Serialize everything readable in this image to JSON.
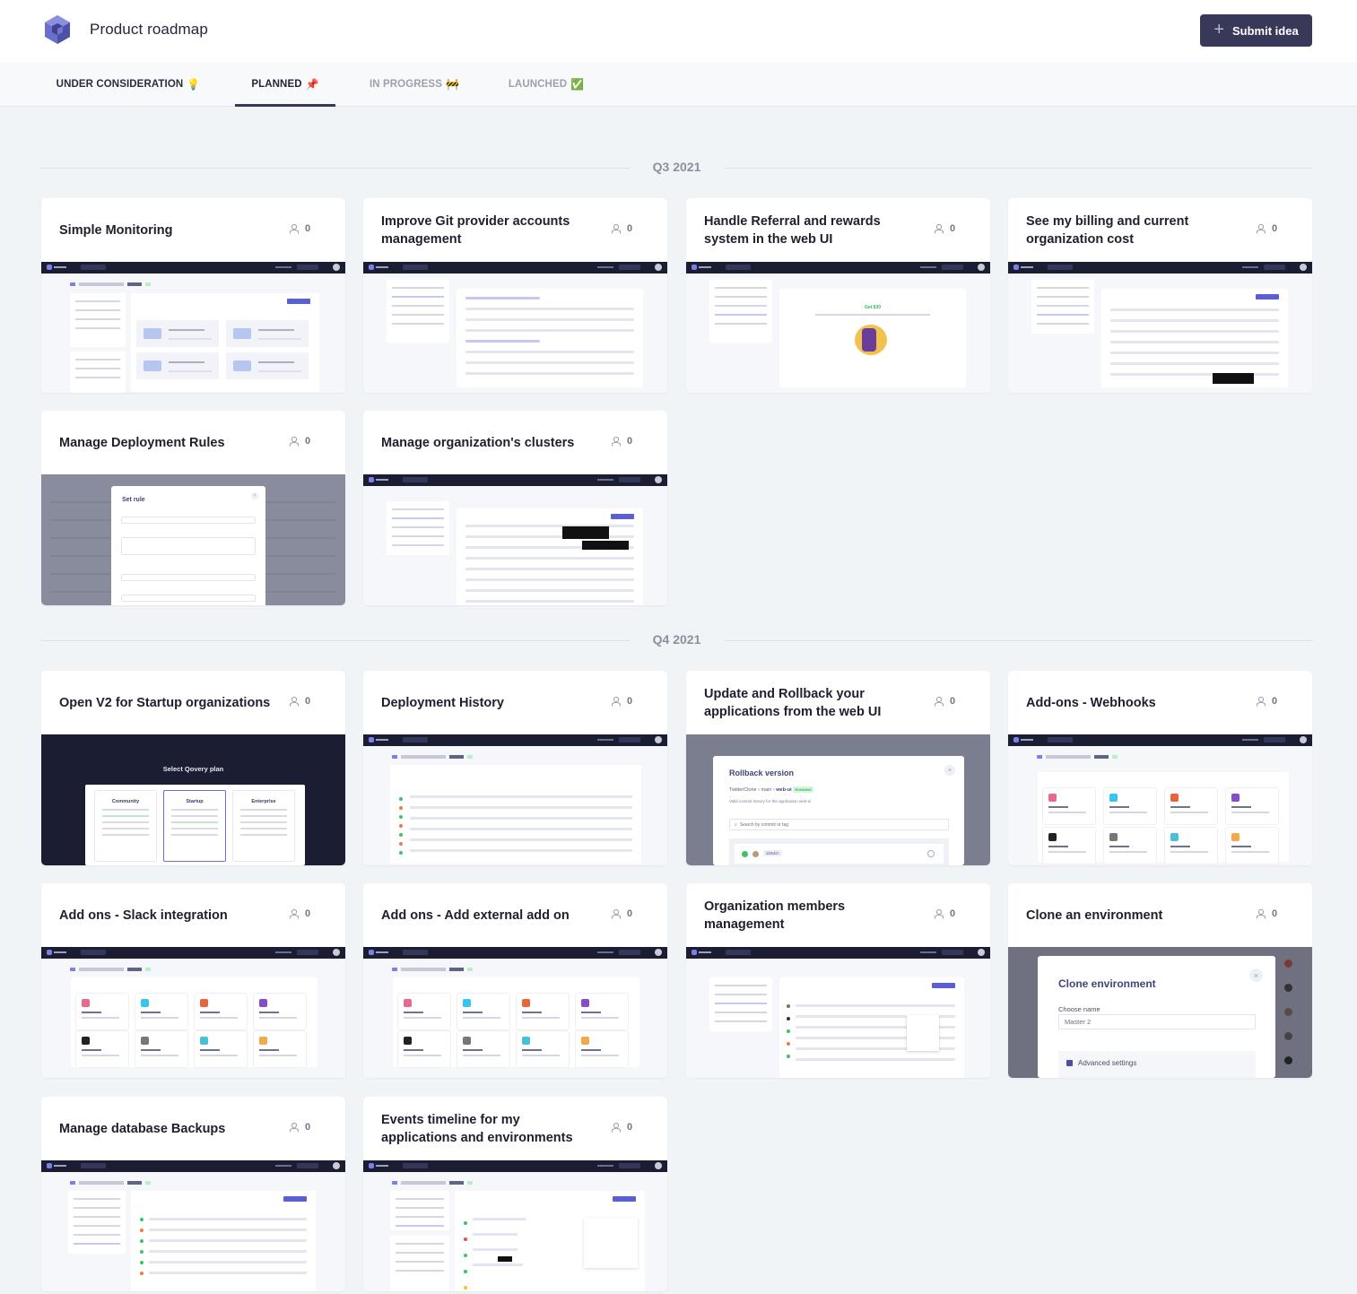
{
  "header": {
    "title": "Product roadmap",
    "submit_button": "Submit idea",
    "submit_icon": "plus-icon",
    "logo_icon": "qovery-cube-logo"
  },
  "tabs": [
    {
      "label": "UNDER CONSIDERATION",
      "emoji": "💡",
      "active": false
    },
    {
      "label": "PLANNED",
      "emoji": "📌",
      "active": true
    },
    {
      "label": "IN PROGRESS",
      "emoji": "🚧",
      "active": false
    },
    {
      "label": "LAUNCHED",
      "emoji": "✅",
      "active": false
    }
  ],
  "colors": {
    "primary": "#383958",
    "background": "#f1f4f7",
    "accent": "#5a5fd3"
  },
  "sections": [
    {
      "label": "Q3 2021",
      "cards": [
        {
          "title": "Simple Monitoring",
          "votes": "0",
          "preview": "Environment summary dashboard (TwitterClone › main › web-ui)"
        },
        {
          "title": "Improve Git provider accounts management",
          "votes": "0",
          "preview": "Account settings – Git permission"
        },
        {
          "title": "Handle Referral and rewards system in the web UI",
          "votes": "0",
          "preview": "Account settings – Get $30 referral"
        },
        {
          "title": "See my billing and current organization cost",
          "votes": "0",
          "preview": "Organization settings – billing"
        },
        {
          "title": "Manage Deployment Rules",
          "votes": "0",
          "preview": "Set rule modal"
        },
        {
          "title": "Manage organization's clusters",
          "votes": "0",
          "preview": "Organization settings – clusters"
        }
      ]
    },
    {
      "label": "Q4 2021",
      "cards": [
        {
          "title": "Open V2 for Startup organizations",
          "votes": "0",
          "preview": "Select Qovery plan"
        },
        {
          "title": "Deployment History",
          "votes": "0",
          "preview": "Deployment history list"
        },
        {
          "title": "Update and Rollback your applications from the web UI",
          "votes": "0",
          "preview": "Rollback version modal"
        },
        {
          "title": "Add-ons - Webhooks",
          "votes": "0",
          "preview": "Add-ons catalog"
        },
        {
          "title": "Add ons - Slack integration",
          "votes": "0",
          "preview": "Add-ons catalog"
        },
        {
          "title": "Add ons - Add external add on",
          "votes": "0",
          "preview": "Add-ons catalog"
        },
        {
          "title": "Organization members management",
          "votes": "0",
          "preview": "Organization settings – members"
        },
        {
          "title": "Clone an environment",
          "votes": "0",
          "preview": "Clone environment modal"
        },
        {
          "title": "Manage database Backups",
          "votes": "0",
          "preview": "Database backups list"
        },
        {
          "title": "Events timeline for my applications and environments",
          "votes": "0",
          "preview": "Events timeline"
        }
      ]
    }
  ],
  "previews": {
    "plan": {
      "title": "Select Qovery plan",
      "plans": [
        "Community",
        "Startup",
        "Enterprise"
      ]
    },
    "rollback": {
      "title": "Rollback version",
      "crumb_project": "TwitterClone",
      "crumb_env": "main",
      "crumb_app": "web-ui",
      "status": "RUNNING",
      "subtitle": "Valid commit history for the application web-ui",
      "search_placeholder": "Search by commit or tag",
      "commit": "d29dch"
    },
    "clone": {
      "title": "Clone environment",
      "name_label": "Choose name",
      "name_value": "Master 2",
      "advanced": "Advanced settings"
    },
    "rule": {
      "title": "Set rule"
    },
    "referral": {
      "title": "Get $30"
    }
  }
}
